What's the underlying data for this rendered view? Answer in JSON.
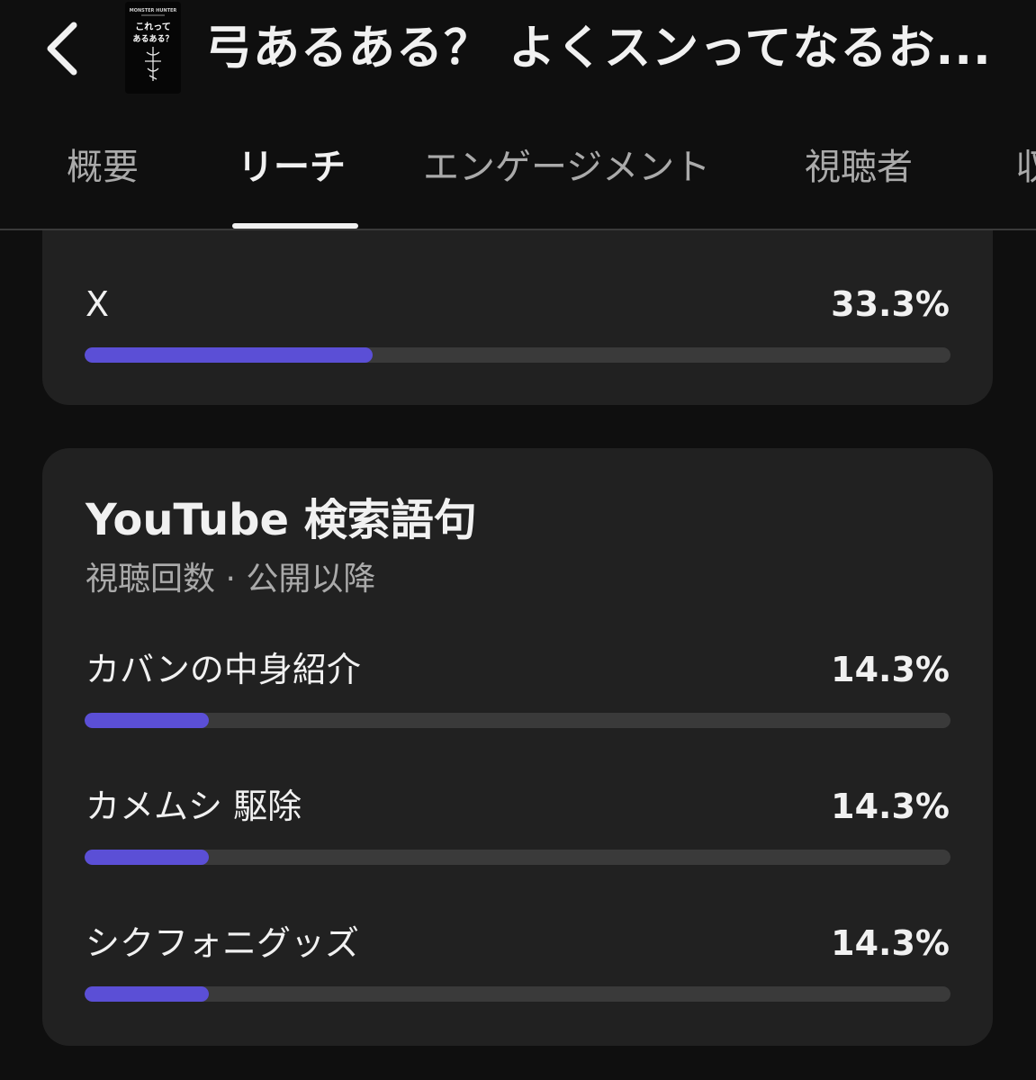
{
  "header": {
    "back_icon": "chevron-left-icon",
    "video_title": "弓あるある？ よくスンってなるお...",
    "thumbnail": {
      "line1": "MONSTER HUNTER",
      "line2": "これって",
      "line3": "あるある？"
    }
  },
  "tabs": [
    {
      "label": "概要",
      "active": false
    },
    {
      "label": "リーチ",
      "active": true
    },
    {
      "label": "エンゲージメント",
      "active": false
    },
    {
      "label": "視聴者",
      "active": false
    },
    {
      "label": "収",
      "active": false
    }
  ],
  "external_sources": {
    "rows": [
      {
        "label": "X",
        "value": "33.3%",
        "fraction": 0.333
      }
    ]
  },
  "search_terms": {
    "title": "YouTube 検索語句",
    "subtitle": "視聴回数 · 公開以降",
    "rows": [
      {
        "label": "カバンの中身紹介",
        "value": "14.3%",
        "fraction": 0.143
      },
      {
        "label": "カメムシ 駆除",
        "value": "14.3%",
        "fraction": 0.143
      },
      {
        "label": "シクフォニグッズ",
        "value": "14.3%",
        "fraction": 0.143
      }
    ]
  },
  "colors": {
    "background": "#0f0f0f",
    "card": "#212121",
    "bar_track": "#3a3a3a",
    "bar_fill": "#5b4fd6",
    "text_primary": "#f1f1f1",
    "text_secondary": "#aaaaaa"
  }
}
